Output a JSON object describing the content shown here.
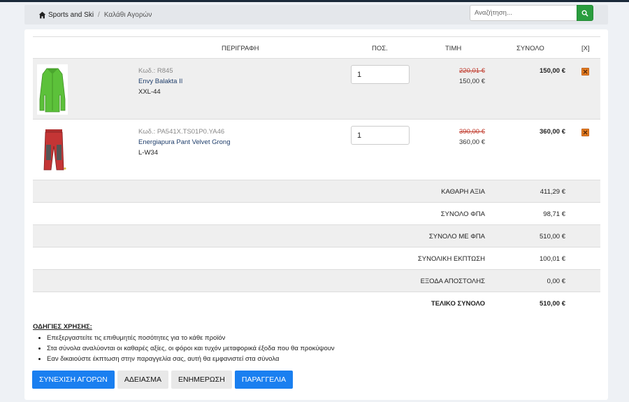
{
  "breadcrumb": {
    "home": "Sports and Ski",
    "current": "Καλάθι Αγορών"
  },
  "search": {
    "placeholder": "Αναζήτηση..."
  },
  "table": {
    "headers": {
      "description": "ΠΕΡΙΓΡΑΦΗ",
      "qty": "ΠΟΣ.",
      "price": "ΤΙΜΗ",
      "total": "ΣΥΝΟΛΟ",
      "remove": "[X]"
    },
    "items": [
      {
        "code": "Κωδ.: R845",
        "name": "Envy Balakta II",
        "size": "XXL-44",
        "qty": "1",
        "old_price": "220,01 €",
        "price": "150,00 €",
        "total": "150,00 €"
      },
      {
        "code": "Κωδ.: PA541X.TS01P0.YA46",
        "name": "Energiapura Pant Velvet Grong",
        "size": "L-W34",
        "qty": "1",
        "old_price": "390,00 €",
        "price": "360,00 €",
        "total": "360,00 €"
      }
    ]
  },
  "totals": [
    {
      "label": "ΚΑΘΑΡΗ ΑΞΙΑ",
      "value": "411,29 €"
    },
    {
      "label": "ΣΥΝΟΛΟ ΦΠΑ",
      "value": "98,71 €"
    },
    {
      "label": "ΣΥΝΟΛΟ ΜΕ ΦΠΑ",
      "value": "510,00 €"
    },
    {
      "label": "ΣΥΝΟΛΙΚΗ ΕΚΠΤΩΣΗ",
      "value": "100,01 €"
    },
    {
      "label": "ΕΞΟΔΑ ΑΠΟΣΤΟΛΗΣ",
      "value": "0,00 €"
    },
    {
      "label": "ΤΕΛΙΚΟ ΣΥΝΟΛΟ",
      "value": "510,00 €"
    }
  ],
  "instructions": {
    "title": "ΟΔΗΓΙΕΣ ΧΡΗΣΗΣ:",
    "items": [
      "Επεξεργαστείτε τις επιθυμητές ποσότητες για το κάθε προϊόν",
      "Στα σύνολα αναλύονται οι καθαρές αξίες, οι φόροι και τυχόν μεταφορικά έξοδα που θα προκύψουν",
      "Εαν δικαιούστε έκπτωση στην παραγγελία σας, αυτή θα εμφανιστεί στα σύνολα"
    ]
  },
  "buttons": {
    "continue": "ΣΥΝΕΧΙΣΗ ΑΓΟΡΩΝ",
    "empty": "ΑΔΕΙΑΣΜΑ",
    "update": "ΕΝΗΜΕΡΩΣΗ",
    "order": "ΠΑΡΑΓΓΕΛΙΑ"
  },
  "colors": {
    "primary": "#1a7ff0",
    "search": "#2a9d3e",
    "strike": "#c0392b",
    "remove": "#e67e22"
  }
}
